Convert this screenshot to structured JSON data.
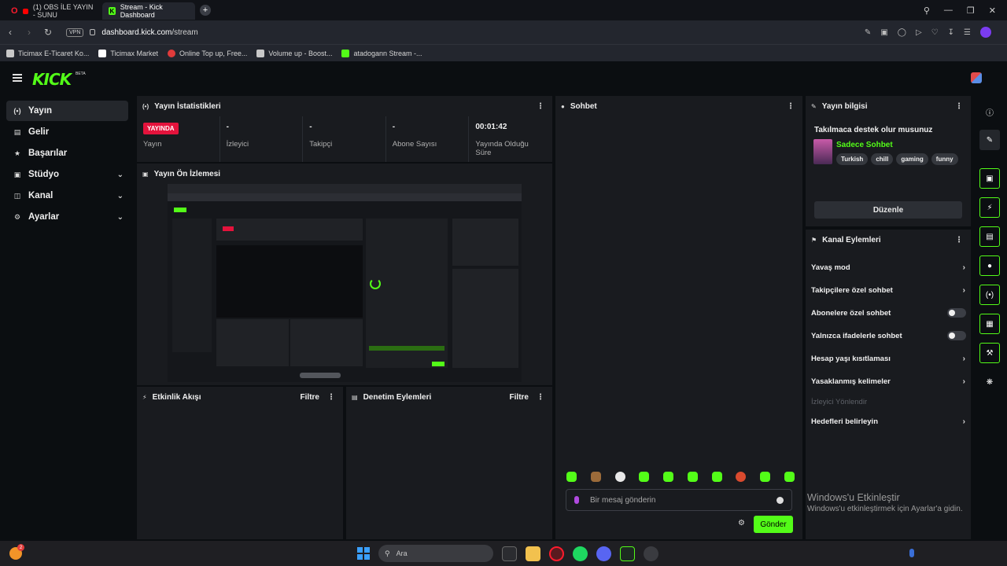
{
  "browser": {
    "tabs": [
      {
        "label": "(1) OBS İLE YAYIN - SUNU",
        "active": false
      },
      {
        "label": "Stream - Kick Dashboard",
        "active": true
      }
    ],
    "url_host": "dashboard.kick.com",
    "url_path": "/stream",
    "vpn_label": "VPN",
    "bookmarks": [
      "Ticimax E-Ticaret Ko...",
      "Ticimax Market",
      "Online Top up, Free...",
      "Volume up - Boost...",
      "atadogann Stream -..."
    ]
  },
  "app": {
    "logo": "KICK",
    "logo_badge": "BETA",
    "accent": "#53fc18"
  },
  "sidebar": {
    "items": [
      {
        "label": "Yayın",
        "icon": "broadcast-icon",
        "active": true
      },
      {
        "label": "Gelir",
        "icon": "money-icon"
      },
      {
        "label": "Başarılar",
        "icon": "trophy-icon"
      },
      {
        "label": "Stüdyo",
        "icon": "studio-icon",
        "expandable": true
      },
      {
        "label": "Kanal",
        "icon": "channel-icon",
        "expandable": true
      },
      {
        "label": "Ayarlar",
        "icon": "gear-icon",
        "expandable": true
      }
    ]
  },
  "stats": {
    "title": "Yayın İstatistikleri",
    "items": [
      {
        "value": "YAYINDA",
        "label": "Yayın"
      },
      {
        "value": "-",
        "label": "İzleyici"
      },
      {
        "value": "-",
        "label": "Takipçi"
      },
      {
        "value": "-",
        "label": "Abone Sayısı"
      },
      {
        "value": "00:01:42",
        "label": "Yayında Olduğu Süre"
      }
    ]
  },
  "preview": {
    "title": "Yayın Ön İzlemesi"
  },
  "events": {
    "title": "Etkinlik Akışı",
    "filter": "Filtre"
  },
  "moderation": {
    "title": "Denetim Eylemleri",
    "filter": "Filtre"
  },
  "chat": {
    "title": "Sohbet",
    "placeholder": "Bir mesaj gönderin",
    "send_label": "Gönder"
  },
  "stream_info": {
    "title": "Yayın bilgisi",
    "stream_title": "Takılmaca destek olur musunuz",
    "category": "Sadece Sohbet",
    "tags": [
      "Turkish",
      "chill",
      "gaming",
      "funny"
    ],
    "edit_label": "Düzenle"
  },
  "channel_actions": {
    "title": "Kanal Eylemleri",
    "items": [
      {
        "label": "Yavaş mod",
        "control": "arrow"
      },
      {
        "label": "Takipçilere özel sohbet",
        "control": "arrow"
      },
      {
        "label": "Abonelere özel sohbet",
        "control": "toggle",
        "on": false
      },
      {
        "label": "Yalnızca ifadelerle sohbet",
        "control": "toggle",
        "on": false
      },
      {
        "label": "Hesap yaşı kısıtlaması",
        "control": "arrow"
      },
      {
        "label": "Yasaklanmış kelimeler",
        "control": "arrow"
      },
      {
        "label": "İzleyici Yönlendir",
        "control": "none",
        "disabled": true
      },
      {
        "label": "Hedefleri belirleyin",
        "control": "arrow"
      }
    ]
  },
  "watermark": {
    "line1": "Windows'u Etkinleştir",
    "line2": "Windows'u etkinleştirmek için Ayarlar'a gidin."
  },
  "taskbar": {
    "search_placeholder": "Ara",
    "notification_count": "2"
  }
}
